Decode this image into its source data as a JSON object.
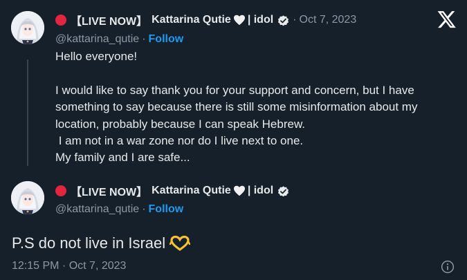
{
  "tweet": {
    "live_prefix": "【LIVE NOW】",
    "display_name": "Kattarina Qutie",
    "name_suffix": "| idol",
    "date": "Oct 7, 2023",
    "handle": "@kattarina_qutie",
    "follow_label": "Follow",
    "body_lines": [
      "Hello everyone!",
      "",
      "I would like to say thank you for your support and concern, but I have",
      "something to say because there is still some misinformation about my",
      "location, probably because I can speak Hebrew.",
      " I am not in a war zone nor do I live next to one.",
      "My family and I are safe..."
    ]
  },
  "quote": {
    "live_prefix": "【LIVE NOW】",
    "display_name": "Kattarina Qutie",
    "name_suffix": "| idol",
    "handle": "@kattarina_qutie",
    "follow_label": "Follow",
    "text": "P.S do not live in Israel",
    "emoji": "heart-hands"
  },
  "footer": {
    "timestamp": "12:15 PM · Oct 7, 2023"
  },
  "icons": {
    "logo": "x-logo-icon",
    "verified": "verified-badge-icon",
    "heart": "white-heart-icon",
    "info": "info-icon"
  },
  "colors": {
    "background": "#15202b",
    "text": "#e7e9ea",
    "muted": "#8b98a5",
    "accent": "#1d9bf0",
    "live_dot": "#e3263f"
  }
}
